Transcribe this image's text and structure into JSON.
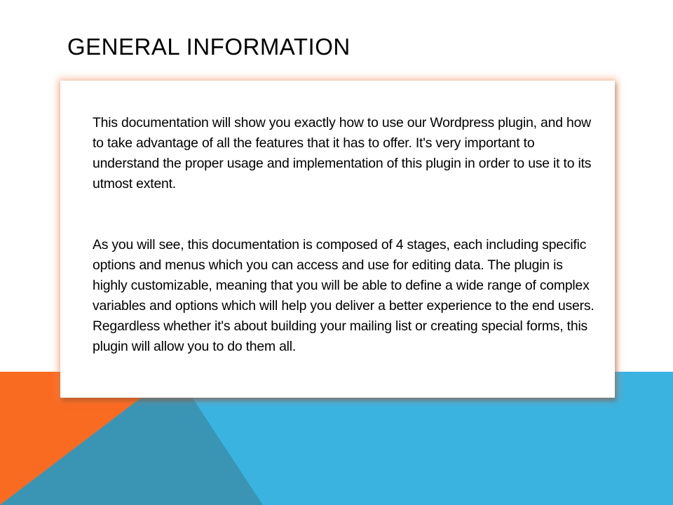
{
  "slide": {
    "title": "General Information",
    "paragraphs": [
      "This documentation will show you exactly how to use our Wordpress plugin, and how to take advantage of all the features that it has to offer. It's very important to understand the proper usage and implementation of this plugin in order to use it to its utmost extent.",
      "As you will see, this documentation is composed of 4 stages, each including specific options and menus which you can access and use for editing data. The plugin is highly customizable, meaning that you will be able to define a wide range of complex variables and options which will help you deliver a better experience to the end users. Regardless whether it's about building your mailing list or creating special forms, this plugin will allow you to do them all."
    ]
  },
  "colors": {
    "orange": "#f96b21",
    "sky_blue": "#3bb3e0",
    "steel_blue": "#3a95b5",
    "box_glow": "#f58c5a"
  }
}
